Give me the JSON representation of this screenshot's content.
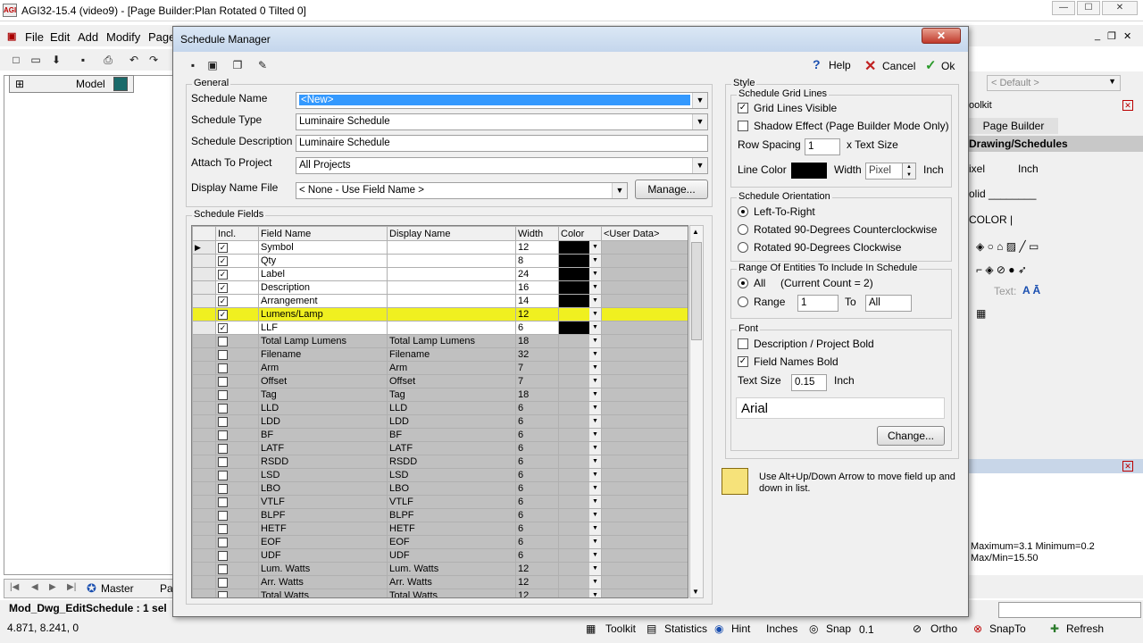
{
  "app": {
    "title": "AGI32-15.4 (video9) - [Page Builder:Plan Rotated 0 Tilted 0]",
    "icon_text": "AGI"
  },
  "menu": [
    "File",
    "Edit",
    "Add",
    "Modify",
    "Page"
  ],
  "left_tab": {
    "label": "Model"
  },
  "bottom_tabs": {
    "master": "Master",
    "page": "Pa"
  },
  "status_left": {
    "line1": "Mod_Dwg_EditSchedule :  1 sel",
    "coords": "4.871, 8.241, 0"
  },
  "statusbar": {
    "toolkit": "Toolkit",
    "statistics": "Statistics",
    "hint": "Hint",
    "inches": "Inches",
    "snap": "Snap",
    "snap_val": "0.1",
    "ortho": "Ortho",
    "snapto": "SnapTo",
    "refresh": "Refresh"
  },
  "right_panel": {
    "default_combo": "< Default >",
    "toolkit": "oolkit",
    "page_builder": "Page Builder",
    "drawing_schedules": "Drawing/Schedules",
    "pixel": "ixel",
    "inch": "Inch",
    "solid": "olid ________",
    "color": "COLOR |",
    "text_label": "Text:",
    "stats1": "Maximum=3.1   Minimum=0.2",
    "stats2": "Max/Min=15.50"
  },
  "dialog": {
    "title": "Schedule Manager",
    "help": "Help",
    "cancel": "Cancel",
    "ok": "Ok",
    "general": {
      "legend": "General",
      "schedule_name_label": "Schedule Name",
      "schedule_name_value": "<New>",
      "schedule_type_label": "Schedule Type",
      "schedule_type_value": "Luminaire Schedule",
      "schedule_desc_label": "Schedule Description",
      "schedule_desc_value": "Luminaire Schedule",
      "attach_label": "Attach To Project",
      "attach_value": "All Projects",
      "display_name_label": "Display Name File",
      "display_name_value": "< None - Use Field Name >",
      "manage": "Manage..."
    },
    "fields": {
      "legend": "Schedule Fields",
      "headers": [
        "Incl.",
        "Field Name",
        "Display Name",
        "Width",
        "Color",
        "<User Data>"
      ],
      "rows": [
        {
          "incl": true,
          "field": "Symbol",
          "display": "",
          "width": "12",
          "state": "on",
          "current": true
        },
        {
          "incl": true,
          "field": "Qty",
          "display": "",
          "width": "8",
          "state": "on"
        },
        {
          "incl": true,
          "field": "Label",
          "display": "",
          "width": "24",
          "state": "on"
        },
        {
          "incl": true,
          "field": "Description",
          "display": "",
          "width": "16",
          "state": "on"
        },
        {
          "incl": true,
          "field": "Arrangement",
          "display": "",
          "width": "14",
          "state": "on"
        },
        {
          "incl": true,
          "field": "Lumens/Lamp",
          "display": "",
          "width": "12",
          "state": "hl"
        },
        {
          "incl": true,
          "field": "LLF",
          "display": "",
          "width": "6",
          "state": "on"
        },
        {
          "incl": false,
          "field": "Total Lamp Lumens",
          "display": "Total Lamp Lumens",
          "width": "18",
          "state": "off"
        },
        {
          "incl": false,
          "field": "Filename",
          "display": "Filename",
          "width": "32",
          "state": "off"
        },
        {
          "incl": false,
          "field": "Arm",
          "display": "Arm",
          "width": "7",
          "state": "off"
        },
        {
          "incl": false,
          "field": "Offset",
          "display": "Offset",
          "width": "7",
          "state": "off"
        },
        {
          "incl": false,
          "field": "Tag",
          "display": "Tag",
          "width": "18",
          "state": "off"
        },
        {
          "incl": false,
          "field": "LLD",
          "display": "LLD",
          "width": "6",
          "state": "off"
        },
        {
          "incl": false,
          "field": "LDD",
          "display": "LDD",
          "width": "6",
          "state": "off"
        },
        {
          "incl": false,
          "field": "BF",
          "display": "BF",
          "width": "6",
          "state": "off"
        },
        {
          "incl": false,
          "field": "LATF",
          "display": "LATF",
          "width": "6",
          "state": "off"
        },
        {
          "incl": false,
          "field": "RSDD",
          "display": "RSDD",
          "width": "6",
          "state": "off"
        },
        {
          "incl": false,
          "field": "LSD",
          "display": "LSD",
          "width": "6",
          "state": "off"
        },
        {
          "incl": false,
          "field": "LBO",
          "display": "LBO",
          "width": "6",
          "state": "off"
        },
        {
          "incl": false,
          "field": "VTLF",
          "display": "VTLF",
          "width": "6",
          "state": "off"
        },
        {
          "incl": false,
          "field": "BLPF",
          "display": "BLPF",
          "width": "6",
          "state": "off"
        },
        {
          "incl": false,
          "field": "HETF",
          "display": "HETF",
          "width": "6",
          "state": "off"
        },
        {
          "incl": false,
          "field": "EOF",
          "display": "EOF",
          "width": "6",
          "state": "off"
        },
        {
          "incl": false,
          "field": "UDF",
          "display": "UDF",
          "width": "6",
          "state": "off"
        },
        {
          "incl": false,
          "field": "Lum. Watts",
          "display": "Lum. Watts",
          "width": "12",
          "state": "off"
        },
        {
          "incl": false,
          "field": "Arr. Watts",
          "display": "Arr. Watts",
          "width": "12",
          "state": "off"
        },
        {
          "incl": false,
          "field": "Total Watts",
          "display": "Total Watts",
          "width": "12",
          "state": "off"
        }
      ]
    },
    "style": {
      "legend": "Style",
      "gridlines": {
        "legend": "Schedule Grid Lines",
        "visible": "Grid Lines Visible",
        "shadow": "Shadow Effect (Page Builder Mode Only)",
        "row_spacing": "Row Spacing",
        "row_spacing_val": "1",
        "x_text": "x Text Size",
        "line_color": "Line Color",
        "width": "Width",
        "width_val": "Pixel",
        "inch": "Inch"
      },
      "orientation": {
        "legend": "Schedule Orientation",
        "ltr": "Left-To-Right",
        "ccw": "Rotated 90-Degrees Counterclockwise",
        "cw": "Rotated 90-Degrees Clockwise"
      },
      "range": {
        "legend": "Range Of Entities To Include In Schedule",
        "all": "All",
        "count": "(Current Count = 2)",
        "range": "Range",
        "from": "1",
        "to": "To",
        "to_val": "All"
      },
      "font": {
        "legend": "Font",
        "desc_bold": "Description / Project Bold",
        "names_bold": "Field Names Bold",
        "text_size": "Text Size",
        "text_size_val": "0.15",
        "inch": "Inch",
        "font_name": "Arial",
        "change": "Change..."
      }
    },
    "note": "Use Alt+Up/Down Arrow to move field up and down in list."
  }
}
